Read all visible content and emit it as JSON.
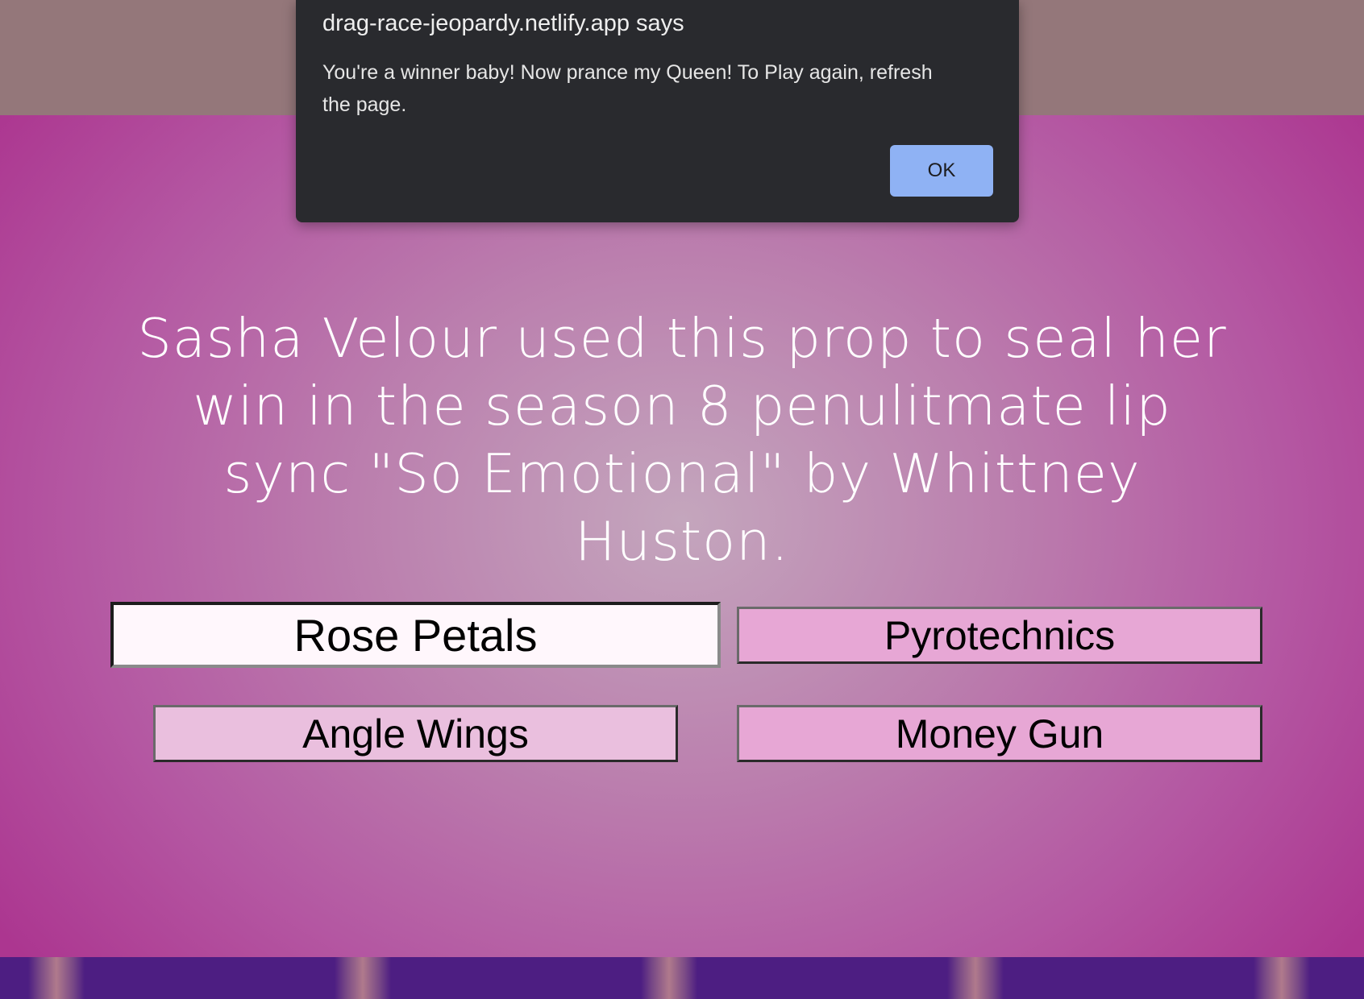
{
  "dialog": {
    "origin": "drag-race-jeopardy.netlify.app says",
    "message": "You're a winner baby! Now prance my Queen! To Play again, refresh the page.",
    "ok_label": "OK"
  },
  "game": {
    "question": "Sasha Velour used this prop to seal her win in the season 8 penulitmate lip sync \"So Emotional\" by Whittney Huston.",
    "answers": [
      {
        "label": "Rose Petals",
        "selected": true
      },
      {
        "label": "Pyrotechnics",
        "selected": false
      },
      {
        "label": "Angle Wings",
        "selected": false
      },
      {
        "label": "Money Gun",
        "selected": false
      }
    ]
  },
  "colors": {
    "dialog_bg": "#292a2e",
    "ok_button": "#8fb2f4",
    "page_center": "#c4a6bd",
    "page_edge": "#ac3690",
    "footer": "#4d1e82"
  }
}
